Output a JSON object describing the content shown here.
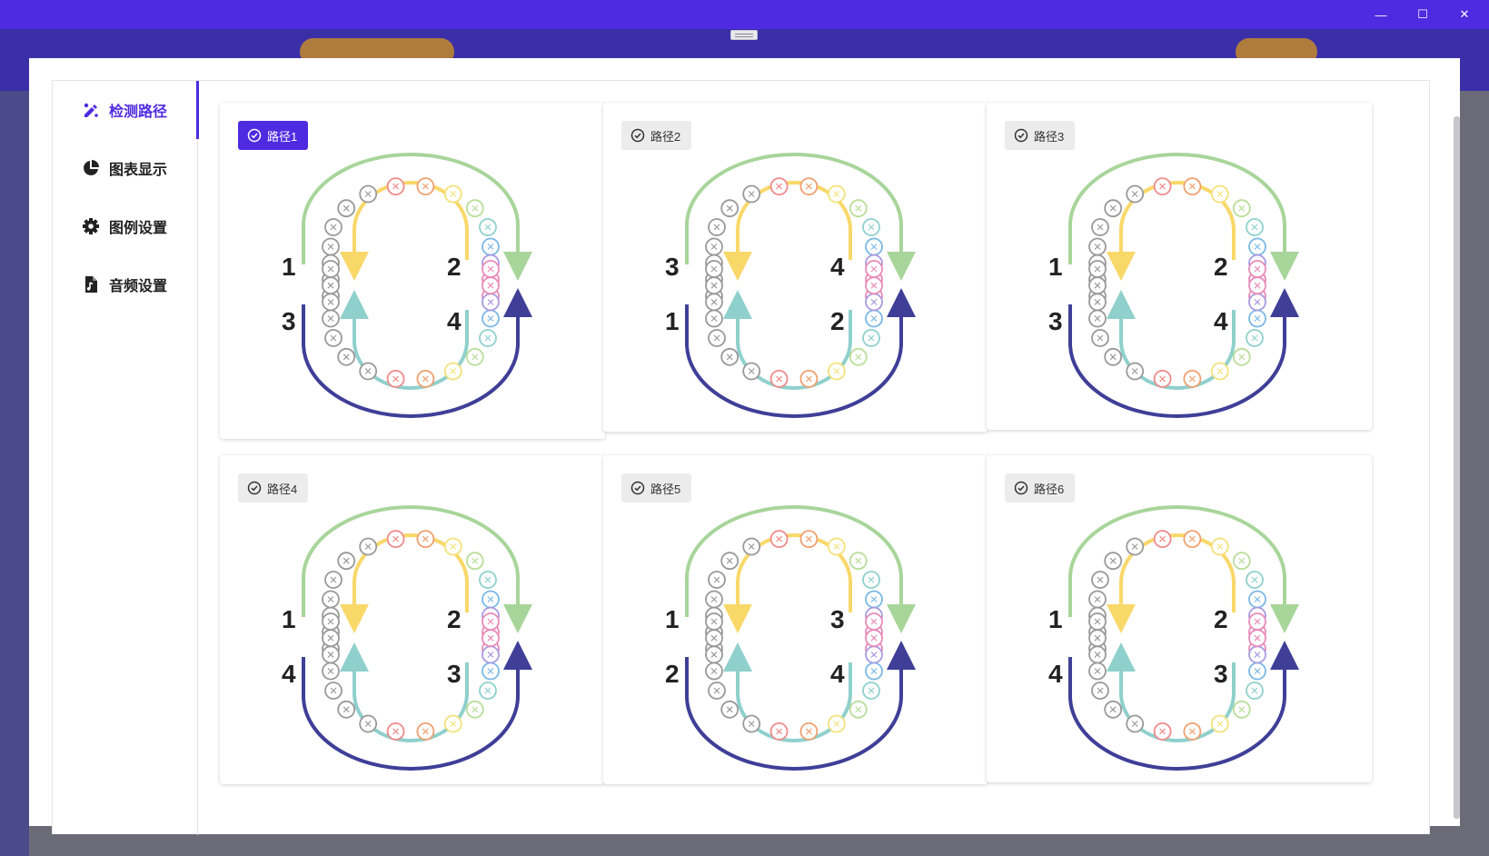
{
  "window": {
    "controls": {
      "minimize": "—",
      "maximize": "☐",
      "close": "✕"
    }
  },
  "sidebar": {
    "items": [
      {
        "label": "检测路径",
        "icon": "path-edit-icon",
        "active": true
      },
      {
        "label": "图表显示",
        "icon": "pie-chart-icon",
        "active": false
      },
      {
        "label": "图例设置",
        "icon": "gear-icon",
        "active": false
      },
      {
        "label": "音频设置",
        "icon": "audio-file-icon",
        "active": false
      }
    ]
  },
  "colors": {
    "accent": "#4e2be0",
    "upper_outer": "#a8d59a",
    "upper_inner": "#f9d86a",
    "lower_inner": "#8fd0cc",
    "lower_outer": "#3f3f98"
  },
  "paths": [
    {
      "label": "路径1",
      "selected": true,
      "nums": {
        "ul": "1",
        "ur": "2",
        "ll": "3",
        "lr": "4"
      }
    },
    {
      "label": "路径2",
      "selected": false,
      "nums": {
        "ul": "3",
        "ur": "4",
        "ll": "1",
        "lr": "2"
      }
    },
    {
      "label": "路径3",
      "selected": false,
      "nums": {
        "ul": "1",
        "ur": "2",
        "ll": "3",
        "lr": "4"
      }
    },
    {
      "label": "路径4",
      "selected": false,
      "nums": {
        "ul": "1",
        "ur": "2",
        "ll": "4",
        "lr": "3"
      }
    },
    {
      "label": "路径5",
      "selected": false,
      "nums": {
        "ul": "1",
        "ur": "3",
        "ll": "2",
        "lr": "4"
      }
    },
    {
      "label": "路径6",
      "selected": false,
      "nums": {
        "ul": "1",
        "ur": "2",
        "ll": "4",
        "lr": "3"
      }
    }
  ]
}
